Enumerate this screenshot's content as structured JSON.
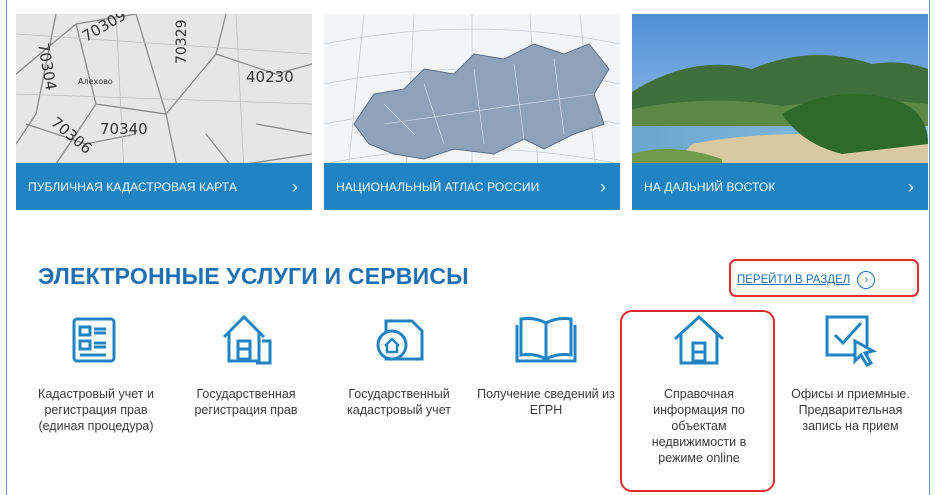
{
  "banners": [
    {
      "label": "ПУБЛИЧНАЯ КАДАСТРОВАЯ КАРТА",
      "chevron": "›"
    },
    {
      "label": "НАЦИОНАЛЬНЫЙ АТЛАС РОССИИ",
      "chevron": "›"
    },
    {
      "label": "НА ДАЛЬНИЙ ВОСТОК",
      "chevron": "›"
    }
  ],
  "map_labels": [
    "70309",
    "70304",
    "70329",
    "40230",
    "70306",
    "70340",
    "Алехово"
  ],
  "section": {
    "title": "ЭЛЕКТРОННЫЕ УСЛУГИ И СЕРВИСЫ",
    "goto_label": "ПЕРЕЙТИ В РАЗДЕЛ",
    "goto_icon": "›"
  },
  "services": [
    {
      "label": "Кадастровый учет и регистрация прав (единая процедура)",
      "icon": "form-icon"
    },
    {
      "label": "Государственная регистрация прав",
      "icon": "house-document-icon"
    },
    {
      "label": "Государственный кадастровый учет",
      "icon": "house-folder-icon"
    },
    {
      "label": "Получение сведений из ЕГРН",
      "icon": "book-icon"
    },
    {
      "label": "Справочная информация по объектам недвижимости в режиме online",
      "icon": "house-icon"
    },
    {
      "label": "Офисы и приемные. Предварительная запись на прием",
      "icon": "cursor-check-icon"
    }
  ],
  "colors": {
    "accent": "#1f83c4",
    "title": "#1f6fb3",
    "highlight": "#e32b2b"
  }
}
